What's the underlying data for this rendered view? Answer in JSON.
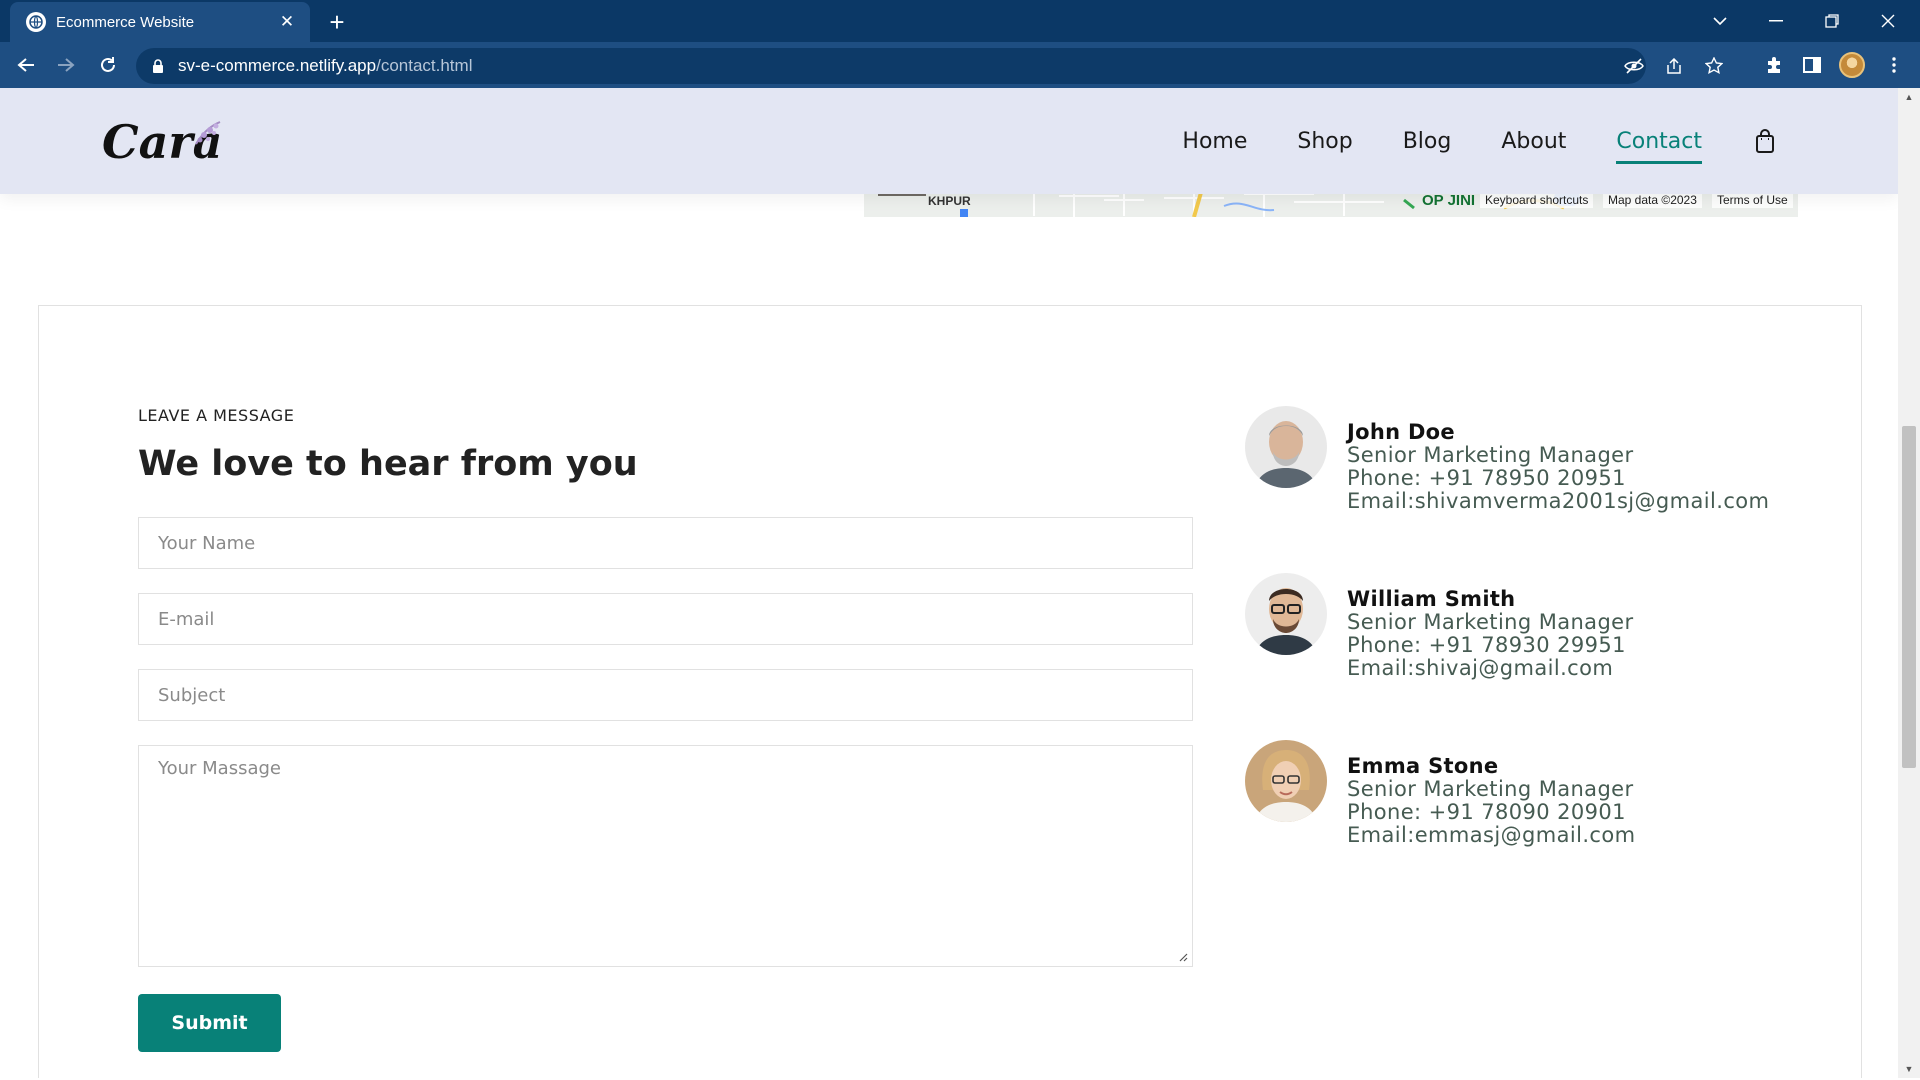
{
  "browser": {
    "tab_title": "Ecommerce Website",
    "url_host": "sv-e-commerce.netlify.app",
    "url_path": "/contact.html"
  },
  "nav": {
    "items": [
      {
        "label": "Home",
        "active": false
      },
      {
        "label": "Shop",
        "active": false
      },
      {
        "label": "Blog",
        "active": false
      },
      {
        "label": "About",
        "active": false
      },
      {
        "label": "Contact",
        "active": true
      }
    ]
  },
  "logo": {
    "text": "Cara"
  },
  "map": {
    "labels": [
      "KHPUR",
      "OP JINI"
    ],
    "keyboard_shortcuts": "Keyboard shortcuts",
    "map_data": "Map data ©2023",
    "terms": "Terms of Use"
  },
  "form": {
    "eyebrow": "LEAVE A MESSAGE",
    "headline": "We love to hear from you",
    "name_placeholder": "Your Name",
    "email_placeholder": "E-mail",
    "subject_placeholder": "Subject",
    "message_placeholder": "Your Massage",
    "submit_label": "Submit"
  },
  "people": [
    {
      "name": "John Doe",
      "title": "Senior Marketing Manager",
      "phone": "Phone: +91 78950 20951",
      "email": "Email:shivamverma2001sj@gmail.com"
    },
    {
      "name": "William Smith",
      "title": "Senior Marketing Manager",
      "phone": "Phone: +91 78930 29951",
      "email": "Email:shivaj@gmail.com"
    },
    {
      "name": "Emma Stone",
      "title": "Senior Marketing Manager",
      "phone": "Phone: +91 78090 20901",
      "email": "Email:emmasj@gmail.com"
    }
  ],
  "colors": {
    "accent": "#088178",
    "header_bg": "#e3e6f3",
    "chrome": "#0b3866"
  }
}
